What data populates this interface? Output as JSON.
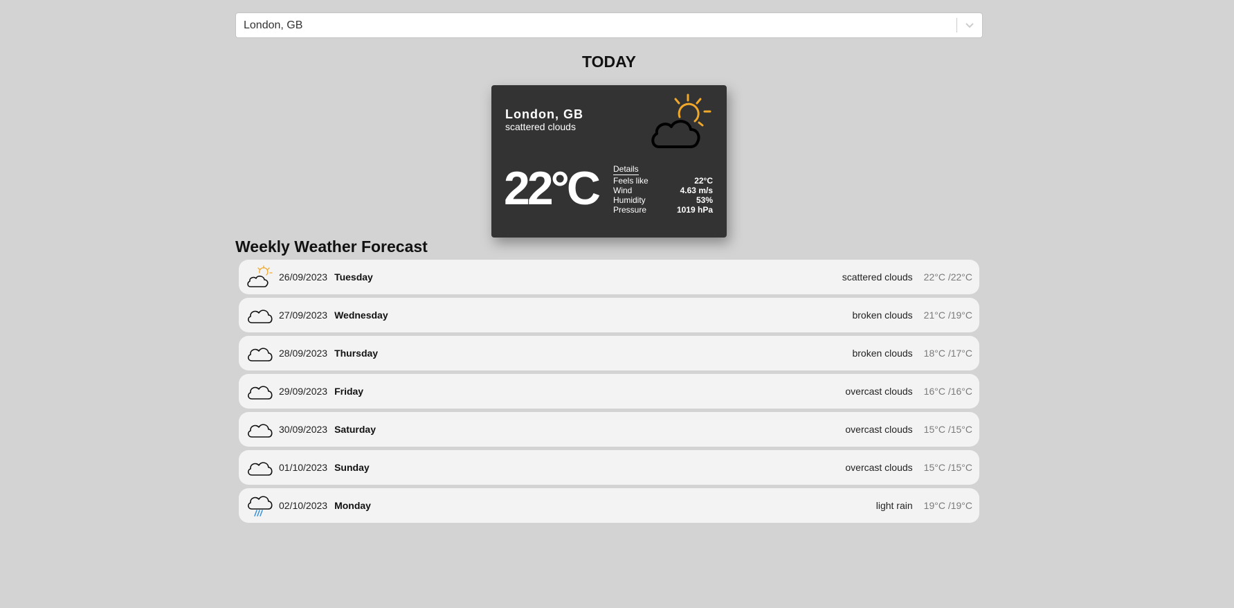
{
  "search": {
    "value": "London, GB"
  },
  "today": {
    "heading": "TODAY",
    "city": "London, GB",
    "description": "scattered clouds",
    "temperature": "22°C",
    "icon": "scattered-clouds-icon",
    "details_label": "Details",
    "details": [
      {
        "label": "Feels like",
        "value": "22°C"
      },
      {
        "label": "Wind",
        "value": "4.63 m/s"
      },
      {
        "label": "Humidity",
        "value": "53%"
      },
      {
        "label": "Pressure",
        "value": "1019 hPa"
      }
    ]
  },
  "weekly": {
    "heading": "Weekly Weather Forecast",
    "days": [
      {
        "date": "26/09/2023",
        "day": "Tuesday",
        "condition": "scattered clouds",
        "minmax": "22°C /22°C",
        "icon": "scattered-clouds-icon"
      },
      {
        "date": "27/09/2023",
        "day": "Wednesday",
        "condition": "broken clouds",
        "minmax": "21°C /19°C",
        "icon": "cloud-icon"
      },
      {
        "date": "28/09/2023",
        "day": "Thursday",
        "condition": "broken clouds",
        "minmax": "18°C /17°C",
        "icon": "cloud-icon"
      },
      {
        "date": "29/09/2023",
        "day": "Friday",
        "condition": "overcast clouds",
        "minmax": "16°C /16°C",
        "icon": "cloud-icon"
      },
      {
        "date": "30/09/2023",
        "day": "Saturday",
        "condition": "overcast clouds",
        "minmax": "15°C /15°C",
        "icon": "cloud-icon"
      },
      {
        "date": "01/10/2023",
        "day": "Sunday",
        "condition": "overcast clouds",
        "minmax": "15°C /15°C",
        "icon": "cloud-icon"
      },
      {
        "date": "02/10/2023",
        "day": "Monday",
        "condition": "light rain",
        "minmax": "19°C /19°C",
        "icon": "rain-icon"
      }
    ]
  },
  "colors": {
    "background": "#d3d3d3",
    "card": "#333333",
    "sun": "#f0a82b",
    "rain": "#3a8fd6",
    "row": "#f3f3f3"
  }
}
